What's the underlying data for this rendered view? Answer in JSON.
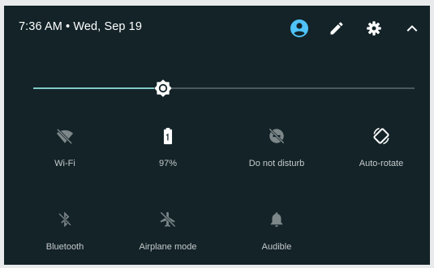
{
  "header": {
    "clock": "7:36 AM • Wed, Sep 19",
    "buttons": [
      "account-icon",
      "pencil-icon",
      "gear-icon",
      "chevron-up-icon"
    ]
  },
  "brightness": {
    "level": 0.34
  },
  "colors": {
    "background": "#132328",
    "accent": "#4fc3f7",
    "slider": "#80cbc4",
    "icon_active": "#ffffff",
    "icon_inactive": "#7d878a",
    "label": "#c5cacc"
  },
  "tiles": [
    {
      "label": "Wi-Fi",
      "icon": "wifi-off-icon",
      "active": false
    },
    {
      "label": "97%",
      "icon": "battery-icon",
      "active": true
    },
    {
      "label": "Do not disturb",
      "icon": "do-not-disturb-off-icon",
      "active": false
    },
    {
      "label": "Auto-rotate",
      "icon": "auto-rotate-icon",
      "active": true
    },
    {
      "label": "Bluetooth",
      "icon": "bluetooth-off-icon",
      "active": false
    },
    {
      "label": "Airplane mode",
      "icon": "airplane-off-icon",
      "active": false
    },
    {
      "label": "Audible",
      "icon": "bell-icon",
      "active": false
    }
  ]
}
